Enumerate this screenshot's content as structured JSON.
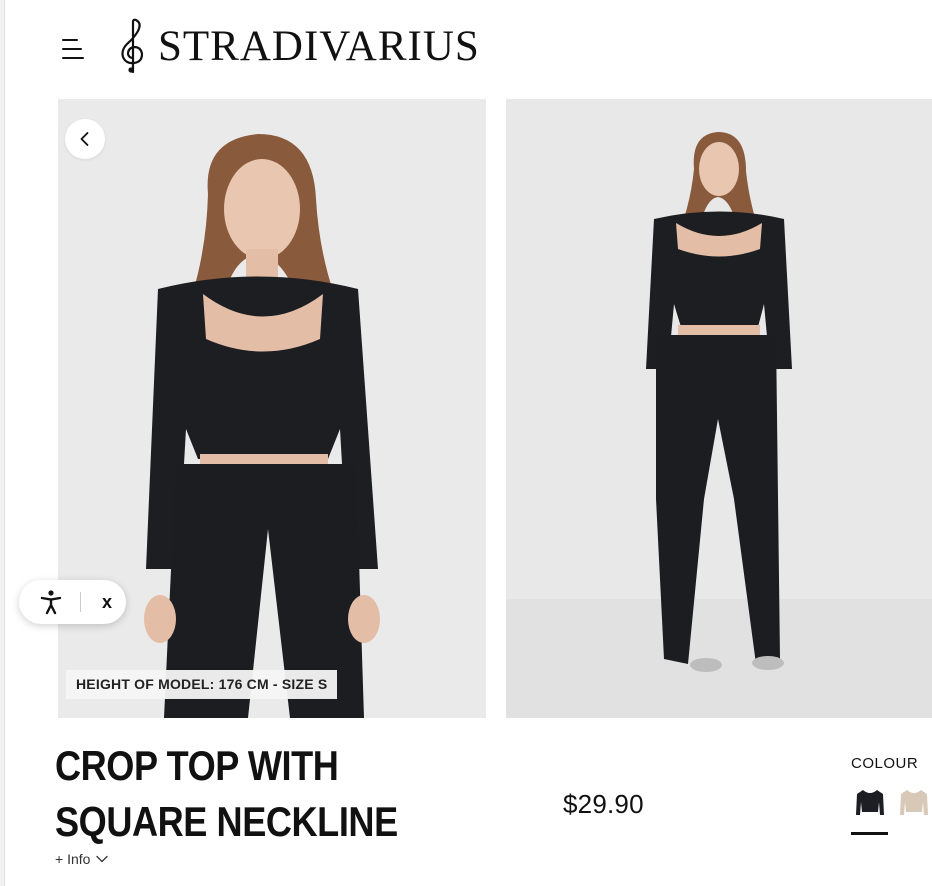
{
  "header": {
    "brand": "STRADIVARIUS",
    "menu_icon": "hamburger-menu-icon",
    "logo_icon": "treble-clef-icon"
  },
  "gallery": {
    "images": [
      {
        "alt": "Model wearing black crop top with square neckline and black flared trousers, front close view"
      },
      {
        "alt": "Model wearing black crop top with square neckline and black flared trousers, full length"
      }
    ],
    "prev_icon": "chevron-left-icon",
    "model_info": "HEIGHT OF MODEL: 176 CM - SIZE S"
  },
  "accessibility_widget": {
    "icon": "accessibility-person-icon",
    "close_label": "x"
  },
  "product": {
    "title": "CROP TOP WITH SQUARE NECKLINE",
    "info_label": "+ Info",
    "info_icon": "chevron-down-icon",
    "price": "$29.90"
  },
  "colour": {
    "label": "COLOUR",
    "options": [
      {
        "name": "Black",
        "color": "#1c1e24",
        "selected": true
      },
      {
        "name": "Beige",
        "color": "#d8c8b8",
        "selected": false
      }
    ]
  }
}
